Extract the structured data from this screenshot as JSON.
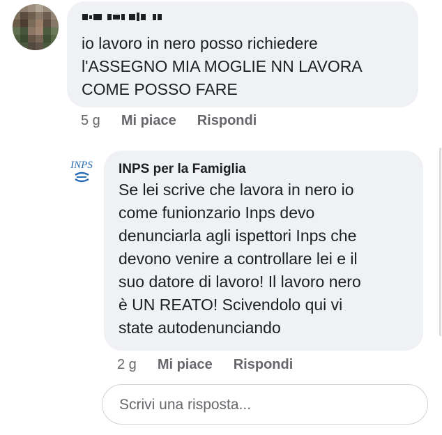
{
  "comment1": {
    "text": "io lavoro in nero posso richiedere\nl'ASSEGNO MIA MOGLIE NN LAVORA\nCOME POSSO FARE",
    "time": "5 g",
    "like_label": "Mi piace",
    "reply_label": "Rispondi"
  },
  "comment2": {
    "author": "INPS per la Famiglia",
    "text": "Se lei scrive che lavora in nero io\ncome funionzario Inps devo\ndenunciarla agli ispettori Inps che\ndevono venire a controllare lei e il\nsuo datore di lavoro! Il lavoro nero\nè UN REATO! Scivendolo qui vi\nstate autodenunciando",
    "time": "2 g",
    "like_label": "Mi piace",
    "reply_label": "Rispondi",
    "logo_text": "INPS"
  },
  "reply": {
    "placeholder": "Scrivi una risposta..."
  },
  "colors": {
    "bubble": "#f0f1f4",
    "text": "#1c1e21",
    "secondary": "#65676b",
    "inps_blue": "#2a6db5"
  }
}
